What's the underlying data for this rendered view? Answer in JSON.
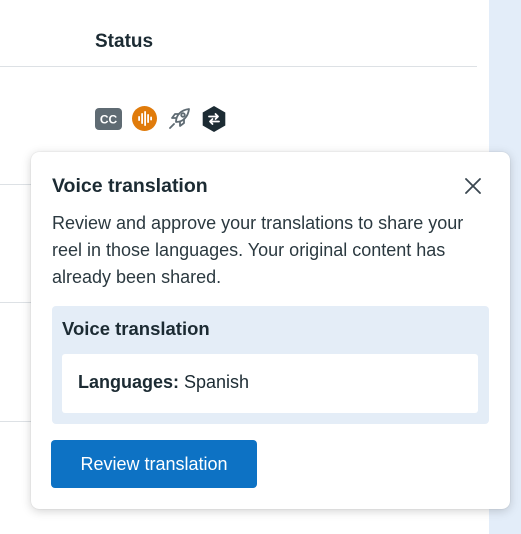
{
  "table": {
    "status_header": "Status",
    "status_icons": [
      {
        "icon": "closed-captions-icon",
        "label": "CC",
        "color": "#5f6b73"
      },
      {
        "icon": "audio-waveform-icon",
        "color": "#e07b0b"
      },
      {
        "icon": "rocket-icon",
        "color": "#5f6b73"
      },
      {
        "icon": "translation-swap-icon",
        "color": "#1c2b33"
      }
    ]
  },
  "popover": {
    "title": "Voice translation",
    "body": "Review and approve your translations to share your reel in those languages. Your original content has already been shared.",
    "card": {
      "title": "Voice translation",
      "languages_label": "Languages:",
      "languages_value": "Spanish"
    },
    "review_button_label": "Review translation"
  },
  "colors": {
    "accent": "#0d72c4",
    "card_background": "#e4edf7",
    "side_panel": "#e3edf9",
    "audio_icon": "#e07b0b"
  }
}
